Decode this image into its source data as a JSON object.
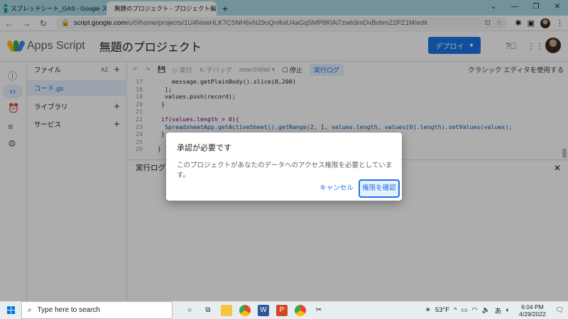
{
  "browser": {
    "tabs": [
      {
        "title": "スプレッドシート_GAS - Google スプレ",
        "icon": "sheets-icon",
        "active": false
      },
      {
        "title": "無題のプロジェクト - プロジェクト編集",
        "icon": "apps-script-icon",
        "active": true
      }
    ],
    "url_host": "script.google.com",
    "url_path": "/u/0/home/projects/1U4NxwHLK7CSNH6xN29uQnlfoiU4aGqSMP8KlAi7zwb3mDvBvbmZ2PZ1M/edit"
  },
  "header": {
    "app_name": "Apps Script",
    "project_title": "無題のプロジェクト",
    "deploy_label": "デプロイ"
  },
  "files": {
    "title": "ファイル",
    "sort_label": "AZ",
    "items": [
      {
        "label": "コード.gs"
      }
    ],
    "libraries_label": "ライブラリ",
    "services_label": "サービス"
  },
  "toolbar": {
    "run_label": "実行",
    "debug_label": "デバッグ",
    "function_name": "searchMail",
    "stop_label": "停止",
    "log_label": "実行ログ",
    "classic_label": "クラシック エディタを使用する"
  },
  "code_lines": [
    {
      "num": "17",
      "code": "    message.getPlainBody().slice(0,200)"
    },
    {
      "num": "18",
      "code": "  ];"
    },
    {
      "num": "19",
      "code": "  values.push(record);"
    },
    {
      "num": "20",
      "code": " }"
    },
    {
      "num": "21",
      "code": ""
    },
    {
      "num": "22",
      "code": " if(values.length > 0){"
    },
    {
      "num": "23",
      "code": "  SpreadsheetApp.getActiveSheet().getRange(2, 1, values.length, values[0].length).setValues(values);"
    },
    {
      "num": "24",
      "code": " }"
    },
    {
      "num": "25",
      "code": ""
    },
    {
      "num": "26",
      "code": "}"
    }
  ],
  "log_panel": {
    "title": "実行ログ"
  },
  "dialog": {
    "title": "承認が必要です",
    "message": "このプロジェクトがあなたのデータへのアクセス権限を必要としています。",
    "cancel_label": "キャンセル",
    "confirm_label": "権限を確認"
  },
  "taskbar": {
    "search_placeholder": "Type here to search",
    "weather": "53°F",
    "ime": "あ",
    "time": "6:04 PM",
    "date": "4/29/2022"
  },
  "colors": {
    "accent": "#1a73e8",
    "tab_bar": "#a8d7e6"
  }
}
